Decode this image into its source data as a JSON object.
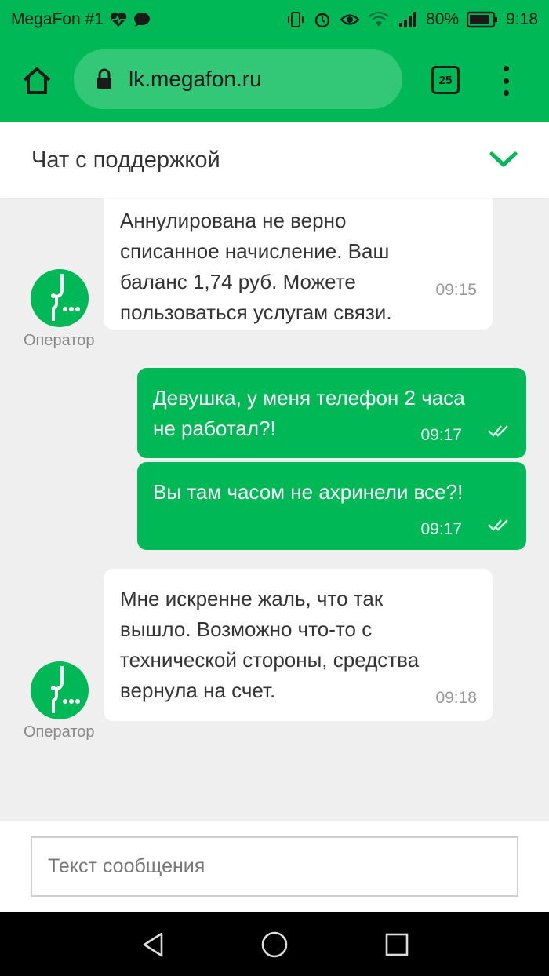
{
  "status_bar": {
    "carrier": "MegaFon #1",
    "battery": "80%",
    "time": "9:18",
    "icons": [
      "heart-pulse-icon",
      "chat-bubble-icon",
      "vibrate-icon",
      "alarm-icon",
      "eye-icon",
      "wifi-icon",
      "signal-icon",
      "battery-icon"
    ]
  },
  "browser": {
    "url": "lk.megafon.ru",
    "tabs_count": "25"
  },
  "chat": {
    "title": "Чат с поддержкой",
    "messages": [
      {
        "from": "operator",
        "lines": [
          "Аннулирована не верно",
          "списанное начисление. Ваш",
          "баланс 1,74 руб. Можете",
          "пользоваться услугам связи."
        ],
        "time": "09:15",
        "sender_label": "Оператор"
      },
      {
        "from": "user",
        "lines": [
          "Девушка, у меня телефон 2 часа",
          "не работал?!"
        ],
        "time": "09:17"
      },
      {
        "from": "user",
        "lines": [
          "Вы там часом не ахринели все?!"
        ],
        "time": "09:17"
      },
      {
        "from": "operator",
        "lines": [
          "Мне искренне жаль, что так",
          "вышло. Возможно что-то с",
          "технической стороны, средства",
          "вернула на счет."
        ],
        "time": "09:18",
        "sender_label": "Оператор"
      }
    ]
  },
  "input": {
    "placeholder": "Текст сообщения"
  },
  "colors": {
    "brand_green": "#00b956",
    "background": "#efefef"
  }
}
